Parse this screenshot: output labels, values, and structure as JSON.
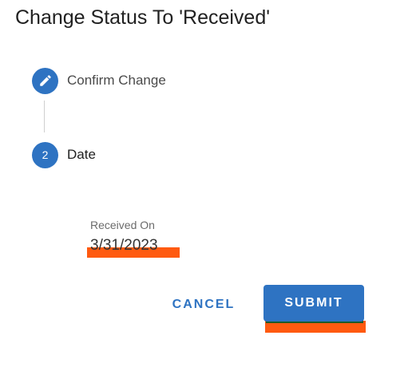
{
  "dialog": {
    "title": "Change Status To 'Received'"
  },
  "stepper": {
    "steps": [
      {
        "label": "Confirm Change",
        "state": "completed",
        "icon": "pencil-icon"
      },
      {
        "label": "Date",
        "state": "active",
        "number": "2"
      }
    ]
  },
  "form": {
    "received_on": {
      "label": "Received On",
      "value": "3/31/2023"
    }
  },
  "actions": {
    "cancel_label": "CANCEL",
    "submit_label": "SUBMIT"
  },
  "colors": {
    "primary": "#2e73c2",
    "highlight": "#ff5a10",
    "title_text": "#212121",
    "muted_text": "#6b6b6b"
  }
}
